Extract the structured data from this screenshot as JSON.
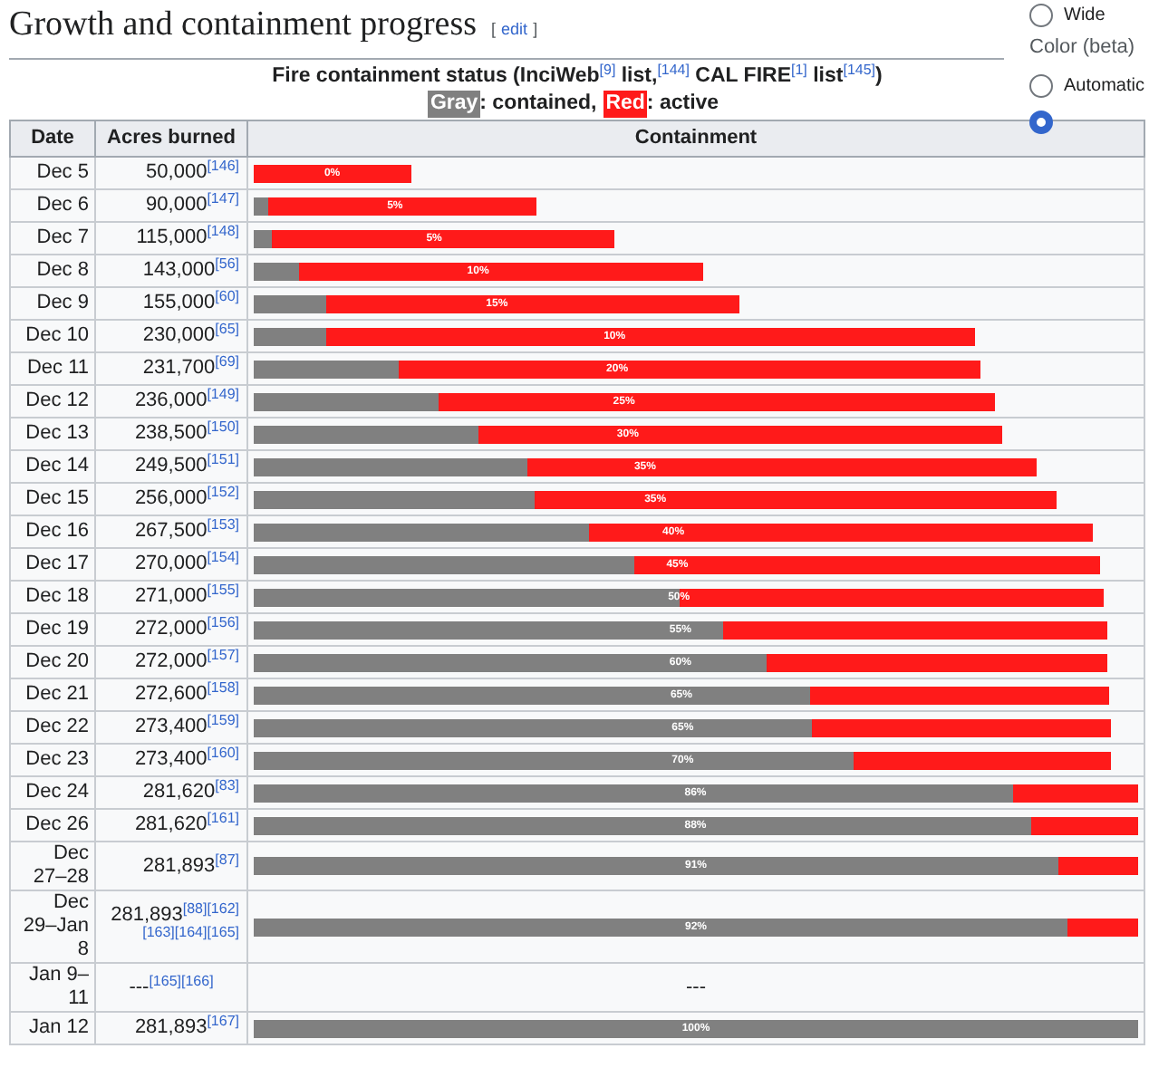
{
  "heading": {
    "title": "Growth and containment progress",
    "edit_open": "[",
    "edit_link": "edit",
    "edit_close": "]"
  },
  "sidebar": {
    "options_top": [
      {
        "label": "Wide",
        "selected": false
      }
    ],
    "color_heading": "Color (beta)",
    "color_options": [
      {
        "label": "Automatic",
        "selected": false
      },
      {
        "selected": true
      }
    ]
  },
  "table": {
    "caption": "Fire containment status (InciWeb$^{[9]}$ list,$^{[144]}$ CAL FIRE$^{[1]}$ list$^{[145]}$)",
    "legend": [
      {
        "label": "Gray",
        "color": "#808080",
        "text": ": contained,"
      },
      {
        "label": "Red",
        "color": "#ff1a1a",
        "text": ": active"
      }
    ],
    "columns": [
      "Date",
      "Acres burned",
      "Containment"
    ],
    "rows": [
      {
        "date": "Dec 5",
        "acres": "50,000",
        "refs": [
          "[146]"
        ],
        "kind": "bar",
        "containment": "0%",
        "level": 0
      },
      {
        "date": "Dec 6",
        "acres": "90,000",
        "refs": [
          "[147]"
        ],
        "kind": "bar",
        "containment": "5%",
        "level": 0.05
      },
      {
        "date": "Dec 7",
        "acres": "115,000",
        "refs": [
          "[148]"
        ],
        "kind": "bar",
        "containment": "5%",
        "level": 0.05
      },
      {
        "date": "Dec 8",
        "acres": "143,000",
        "refs": [
          "[56]"
        ],
        "kind": "bar",
        "containment": "10%",
        "level": 0.1
      },
      {
        "date": "Dec 9",
        "acres": "155,000",
        "refs": [
          "[60]"
        ],
        "kind": "bar",
        "containment": "15%",
        "level": 0.15
      },
      {
        "date": "Dec 10",
        "acres": "230,000",
        "refs": [
          "[65]"
        ],
        "kind": "bar",
        "containment": "10%",
        "level": 0.1
      },
      {
        "date": "Dec 11",
        "acres": "231,700",
        "refs": [
          "[69]"
        ],
        "kind": "bar",
        "containment": "20%",
        "level": 0.2
      },
      {
        "date": "Dec 12",
        "acres": "236,000",
        "refs": [
          "[149]"
        ],
        "kind": "bar",
        "containment": "25%",
        "level": 0.25
      },
      {
        "date": "Dec 13",
        "acres": "238,500",
        "refs": [
          "[150]"
        ],
        "kind": "bar",
        "containment": "30%",
        "level": 0.3
      },
      {
        "date": "Dec 14",
        "acres": "249,500",
        "refs": [
          "[151]"
        ],
        "kind": "bar",
        "containment": "35%",
        "level": 0.35
      },
      {
        "date": "Dec 15",
        "acres": "256,000",
        "refs": [
          "[152]"
        ],
        "kind": "bar",
        "containment": "35%",
        "level": 0.35
      },
      {
        "date": "Dec 16",
        "acres": "267,500",
        "refs": [
          "[153]"
        ],
        "kind": "bar",
        "containment": "40%",
        "level": 0.4
      },
      {
        "date": "Dec 17",
        "acres": "270,000",
        "refs": [
          "[154]"
        ],
        "kind": "bar",
        "containment": "45%",
        "level": 0.45
      },
      {
        "date": "Dec 18",
        "acres": "271,000",
        "refs": [
          "[155]"
        ],
        "kind": "bar",
        "containment": "50%",
        "level": 0.5
      },
      {
        "date": "Dec 19",
        "acres": "272,000",
        "refs": [
          "[156]"
        ],
        "kind": "bar",
        "containment": "55%",
        "level": 0.55
      },
      {
        "date": "Dec 20",
        "acres": "272,000",
        "refs": [
          "[157]"
        ],
        "kind": "bar",
        "containment": "60%",
        "level": 0.6
      },
      {
        "date": "Dec 21",
        "acres": "272,600",
        "refs": [
          "[158]"
        ],
        "kind": "bar",
        "containment": "65%",
        "level": 0.65
      },
      {
        "date": "Dec 22",
        "acres": "273,400",
        "refs": [
          "[159]"
        ],
        "kind": "bar",
        "containment": "65%",
        "level": 0.65
      },
      {
        "date": "Dec 23",
        "acres": "273,400",
        "refs": [
          "[160]"
        ],
        "kind": "bar",
        "containment": "70%",
        "level": 0.7
      },
      {
        "date": "Dec 24",
        "acres": "281,620",
        "refs": [
          "[83]"
        ],
        "kind": "bar",
        "containment": "86%",
        "level": 0.86
      },
      {
        "date": "Dec 26",
        "acres": "281,620",
        "refs": [
          "[161]"
        ],
        "kind": "bar",
        "containment": "88%",
        "level": 0.88
      },
      {
        "date": "Dec 27–28",
        "acres": "281,893",
        "refs": [
          "[87]"
        ],
        "kind": "bar",
        "containment": "91%",
        "level": 0.91
      },
      {
        "date": "Dec 29–Jan 8",
        "acres": "281,893",
        "refs": [
          "[88]",
          "[162]",
          "[163]",
          "[164]",
          "[165]"
        ],
        "kind": "bar",
        "containment": "92%",
        "level": 0.92
      },
      {
        "date": "Jan 9–11",
        "acres": "---",
        "refs": [
          "[165]",
          "[166]"
        ],
        "kind": "text",
        "containment": "---"
      },
      {
        "date": "Jan 12",
        "acres": "281,893",
        "refs": [
          "[167]"
        ],
        "kind": "bar",
        "containment": "100%",
        "level": 1
      }
    ]
  }
}
